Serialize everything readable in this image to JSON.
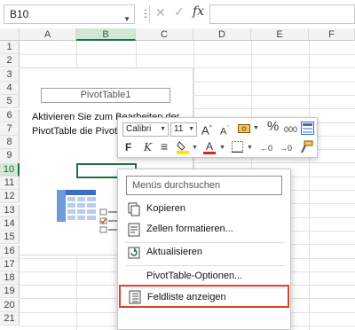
{
  "formula_bar": {
    "name_box": "B10",
    "more_icon": "vertical-ellipsis-icon",
    "cancel_icon": "✕",
    "enter_icon": "✓",
    "function_label": "fx",
    "formula_value": ""
  },
  "columns": [
    "A",
    "B",
    "C",
    "D",
    "E",
    "F"
  ],
  "rows": [
    "1",
    "2",
    "3",
    "4",
    "5",
    "6",
    "7",
    "8",
    "9",
    "10",
    "11",
    "12",
    "13",
    "14",
    "15",
    "16",
    "17",
    "18",
    "19",
    "20",
    "21"
  ],
  "selected_cell": {
    "column": "B",
    "row": "10"
  },
  "pivot": {
    "title": "PivotTable1",
    "hint_line1": "Aktivieren Sie zum Bearbeiten der",
    "hint_line2": "PivotTable die Pivot"
  },
  "mini_toolbar": {
    "font_name": "Calibri",
    "font_size": "11",
    "grow_font": "A",
    "shrink_font": "A",
    "number_format_icon": "currency-format-icon",
    "percent": "%",
    "thousands": "000",
    "bold": "F",
    "italic": "K",
    "align": "≡",
    "fill_color": "#ffe600",
    "font_color": "#e02020",
    "borders_icon": "borders-icon",
    "decimal_increase": "←0",
    "decimal_decrease": "→0",
    "format_painter_icon": "format-painter-icon"
  },
  "context_menu": {
    "search_placeholder": "Menüs durchsuchen",
    "items": [
      {
        "label": "Kopieren",
        "icon": "copy-icon"
      },
      {
        "label": "Zellen formatieren...",
        "icon": "format-cells-icon"
      },
      {
        "label": "Aktualisieren",
        "icon": "refresh-icon"
      },
      {
        "label": "PivotTable-Optionen...",
        "icon": ""
      },
      {
        "label": "Feldliste anzeigen",
        "icon": "field-list-icon",
        "highlighted": true
      }
    ]
  },
  "colors": {
    "accent_green": "#1e7145",
    "highlight_border": "#d9452b"
  }
}
